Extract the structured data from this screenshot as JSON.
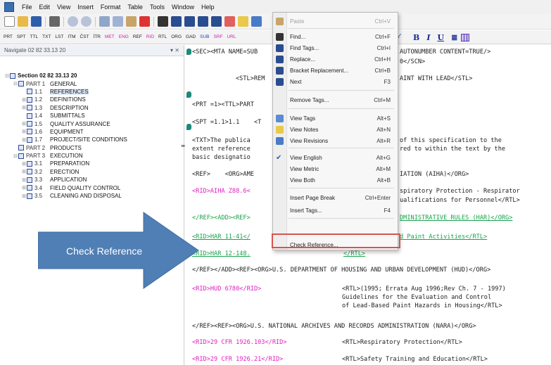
{
  "menubar": {
    "items": [
      "File",
      "Edit",
      "View",
      "Insert",
      "Format",
      "Table",
      "Tools",
      "Window",
      "Help"
    ]
  },
  "tag_toolbar": {
    "buttons": [
      "PRT",
      "SPT",
      "TTL",
      "TXT",
      "LST",
      "ITM",
      "ČST",
      "ÍTR",
      "MET",
      "ENG",
      "REF",
      "RID",
      "RTL",
      "ORG",
      "GAD",
      "SUB",
      "SRF",
      "URL"
    ]
  },
  "format_toolbar": {
    "bold": "B",
    "italic": "I",
    "underline": "U"
  },
  "navpane": {
    "title": "Navigate 02 82 33.13 20",
    "pin_label": "▾ ⨯",
    "tree": [
      {
        "expander": "⊟",
        "num": "",
        "label": "Section 02 82 33.13 20",
        "level": 0,
        "bold": true
      },
      {
        "expander": "⊟",
        "num": "PART 1",
        "label": "GENERAL",
        "level": 1
      },
      {
        "expander": "",
        "num": "1.1",
        "label": "REFERENCES",
        "level": 2,
        "selected": true
      },
      {
        "expander": "⊞",
        "num": "1.2",
        "label": "DEFINITIONS",
        "level": 2
      },
      {
        "expander": "⊞",
        "num": "1.3",
        "label": "DESCRIPTION",
        "level": 2
      },
      {
        "expander": "",
        "num": "1.4",
        "label": "SUBMITTALS",
        "level": 2
      },
      {
        "expander": "⊞",
        "num": "1.5",
        "label": "QUALITY ASSURANCE",
        "level": 2
      },
      {
        "expander": "⊞",
        "num": "1.6",
        "label": "EQUIPMENT",
        "level": 2
      },
      {
        "expander": "⊞",
        "num": "1.7",
        "label": "PROJECT/SITE CONDITIONS",
        "level": 2
      },
      {
        "expander": "",
        "num": "PART 2",
        "label": "PRODUCTS",
        "level": 1
      },
      {
        "expander": "⊟",
        "num": "PART 3",
        "label": "EXECUTION",
        "level": 1
      },
      {
        "expander": "⊞",
        "num": "3.1",
        "label": "PREPARATION",
        "level": 2
      },
      {
        "expander": "⊞",
        "num": "3.2",
        "label": "ERECTION",
        "level": 2
      },
      {
        "expander": "⊞",
        "num": "3.3",
        "label": "APPLICATION",
        "level": 2
      },
      {
        "expander": "⊞",
        "num": "3.4",
        "label": "FIELD QUALITY CONTROL",
        "level": 2
      },
      {
        "expander": "⊞",
        "num": "3.5",
        "label": "CLEANING AND DISPOSAL",
        "level": 2
      }
    ]
  },
  "editor": {
    "lines": [
      {
        "text": "<SEC><MTA NAME=SUB",
        "color": "#222"
      },
      {
        "text": "AUTONUMBER CONTENT=TRUE/>",
        "color": "#222"
      },
      {
        "text": "0</SCN>",
        "color": "#222"
      },
      {
        "text": "<STL>REM",
        "color": "#222"
      },
      {
        "text": "AINT WITH LEAD</STL>",
        "color": "#222"
      },
      {
        "text": "<PRT =1><TTL>PART",
        "color": "#222"
      },
      {
        "text": "<SPT =1.1>1.1    <T",
        "color": "#222"
      },
      {
        "text": "<TXT>The publica",
        "color": "#222"
      },
      {
        "text": "of this specification to the",
        "color": "#222"
      },
      {
        "text": "extent reference",
        "color": "#222"
      },
      {
        "text": "red to within the text by the",
        "color": "#222"
      },
      {
        "text": "basic designatio",
        "color": "#222"
      },
      {
        "text": "<REF>    <ORG>AME",
        "color": "#222"
      },
      {
        "text": "IATION (AIHA)</ORG>",
        "color": "#222"
      },
      {
        "text": "<RID>AIHA Z88.6<",
        "color": "pink"
      },
      {
        "text": "spiratory Protection - Respirator",
        "color": "#222"
      },
      {
        "text": "ualifications for Personnel</RTL>",
        "color": "#222"
      },
      {
        "text": "</REF><ADD><REF>",
        "color": "mixed"
      },
      {
        "text": "DMINISTRATIVE RULES (HAR)</ORG>",
        "color": "green"
      },
      {
        "text": "<RID>HAR 11-41</",
        "color": "green"
      },
      {
        "text": "d Paint Activities</RTL>",
        "color": "green"
      },
      {
        "text": "<RID>HAR 12-148.",
        "color": "green"
      },
      {
        "text": "</RTL>",
        "color": "green"
      },
      {
        "text": "</REF></ADD><REF><ORG>U.S. DEPARTMENT OF HOUSING AND URBAN DEVELOPMENT (HUD)</ORG>",
        "color": "mixed2"
      },
      {
        "text": "<RID>HUD 6780</RID>",
        "color": "pink"
      },
      {
        "text": "<RTL>(1995; Errata Aug 1996;Rev Ch. 7 - 1997)",
        "color": "#222"
      },
      {
        "text": "Guidelines for the Evaluation and Control",
        "color": "#222"
      },
      {
        "text": "of Lead-Based Paint Hazards in Housing</RTL>",
        "color": "#222"
      },
      {
        "text": "</REF><REF><ORG>U.S. NATIONAL ARCHIVES AND RECORDS ADMINISTRATION (NARA)</ORG>",
        "color": "#222"
      },
      {
        "text": "<RID>29 CFR 1926.103</RID>",
        "color": "pink"
      },
      {
        "text": "<RTL>Respiratory Protection</RTL>",
        "color": "#222"
      },
      {
        "text": "<RID>29 CFR 1926.21</RID>",
        "color": "pink"
      },
      {
        "text": "<RTL>Safety Training and Education</RTL>",
        "color": "#222"
      }
    ]
  },
  "context_menu": {
    "items": [
      {
        "label": "Paste",
        "shortcut": "Ctrl+V",
        "disabled": true,
        "icon": "paste-icon"
      },
      {
        "label": "Find...",
        "shortcut": "Ctrl+F",
        "icon": "find-icon"
      },
      {
        "label": "Find Tags...",
        "shortcut": "Ctrl+I",
        "icon": "find-tags-icon"
      },
      {
        "label": "Replace...",
        "shortcut": "Ctrl+H",
        "icon": "replace-icon"
      },
      {
        "label": "Bracket Replacement...",
        "shortcut": "Ctrl+B",
        "icon": "bracket-replace-icon"
      },
      {
        "label": "Next",
        "shortcut": "F3",
        "icon": "find-next-icon"
      },
      {
        "label": "Remove Tags...",
        "shortcut": "Ctrl+M",
        "icon": ""
      },
      {
        "label": "View Tags",
        "shortcut": "Alt+S",
        "icon": "view-tags-icon"
      },
      {
        "label": "View Notes",
        "shortcut": "Alt+N",
        "icon": "view-notes-icon"
      },
      {
        "label": "View Revisions",
        "shortcut": "Alt+R",
        "icon": "view-revisions-icon"
      },
      {
        "label": "View English",
        "shortcut": "Alt+G",
        "icon": "checkmark-icon"
      },
      {
        "label": "View Metric",
        "shortcut": "Alt+M",
        "icon": ""
      },
      {
        "label": "View Both",
        "shortcut": "Alt+B",
        "icon": ""
      },
      {
        "label": "Insert Page Break",
        "shortcut": "Ctrl+Enter",
        "icon": ""
      },
      {
        "label": "Insert Tags...",
        "shortcut": "F4",
        "icon": ""
      },
      {
        "label": "Check Reference...",
        "shortcut": "",
        "icon": ""
      }
    ]
  },
  "callout": {
    "text": "Check Reference",
    "color": "#4f7fb5"
  },
  "colors": {
    "pink": "#e020c0",
    "green": "#17a34a",
    "highlight_border": "#d9534f"
  }
}
